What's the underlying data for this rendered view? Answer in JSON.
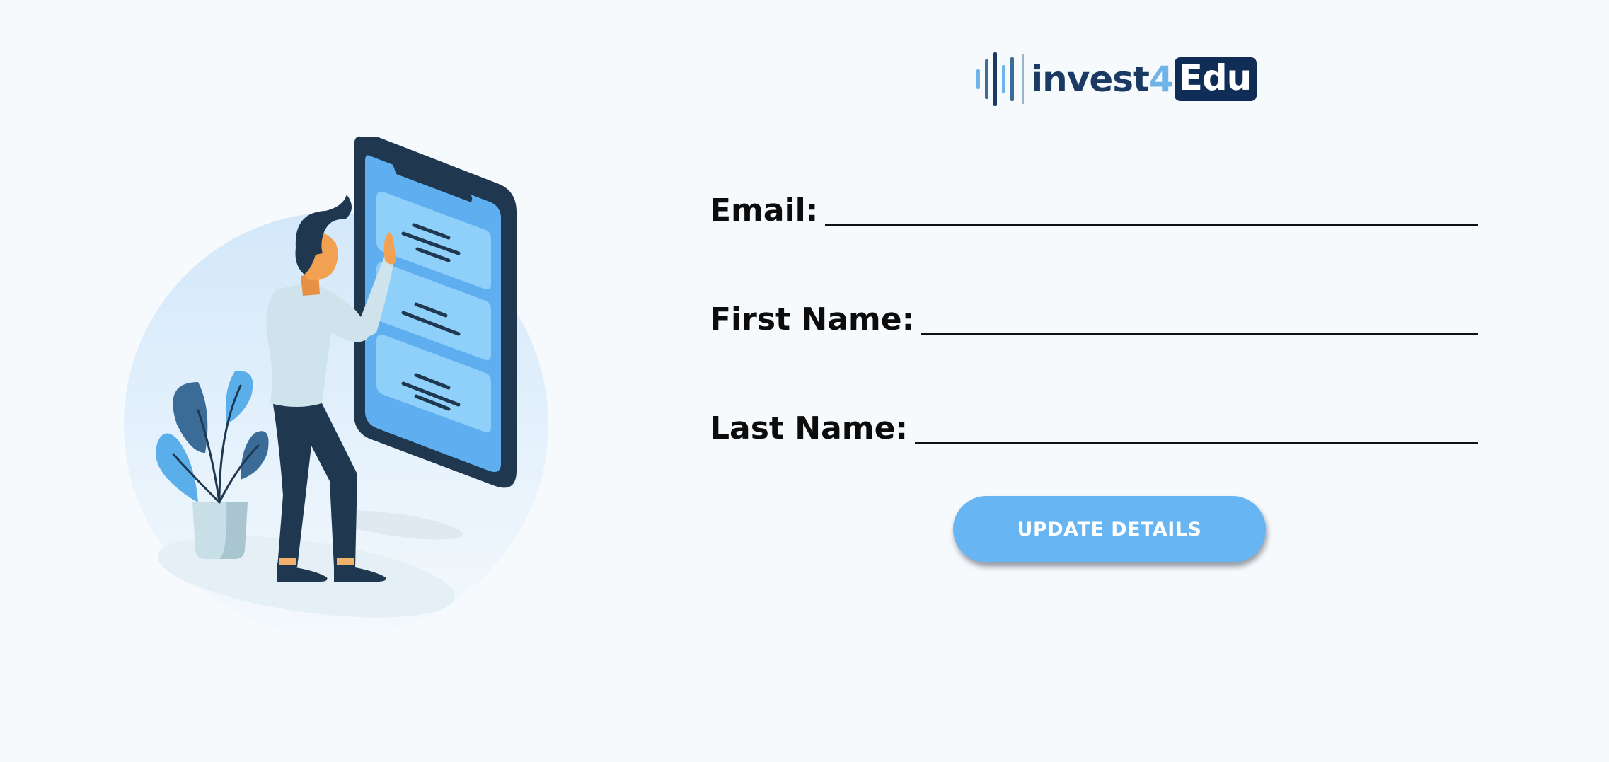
{
  "brand": {
    "logo_main": "invest",
    "logo_four": "4",
    "logo_box": "Edu",
    "colors": {
      "navy": "#0f2d57",
      "text_navy": "#1b3a63",
      "light_blue": "#6fb4e8"
    }
  },
  "illustration": {
    "icon": "person-tapping-phone-illustration"
  },
  "form": {
    "email_label": "Email:",
    "first_name_label": "First Name:",
    "last_name_label": "Last Name:",
    "email_value": "",
    "first_name_value": "",
    "last_name_value": ""
  },
  "actions": {
    "update_label": "UPDATE DETAILS",
    "accent": "#68b5f3"
  }
}
